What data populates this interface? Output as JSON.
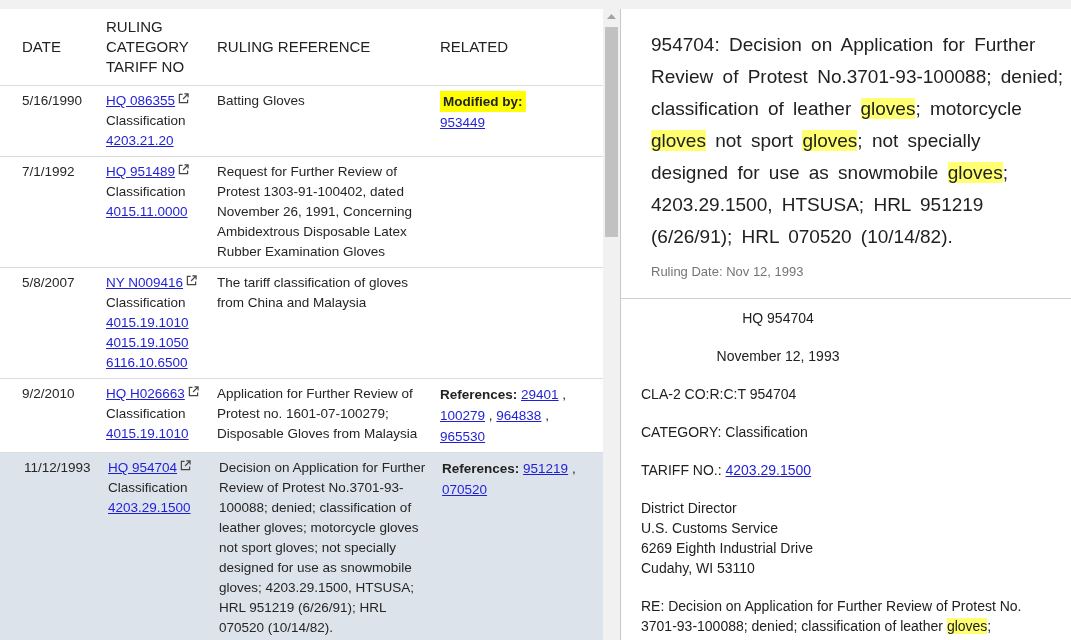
{
  "table": {
    "columns": [
      "DATE",
      "RULING CATEGORY TARIFF NO",
      "RULING REFERENCE",
      "RELATED"
    ],
    "rows": [
      {
        "selected": false,
        "date": "5/16/1990",
        "ruling": "HQ 086355",
        "category": "Classification",
        "tariffs": [
          "4203.21.20"
        ],
        "reference": "Batting Gloves",
        "related": {
          "label": "Modified by:",
          "highlighted": true,
          "links": [
            "953449"
          ]
        }
      },
      {
        "selected": false,
        "date": "7/1/1992",
        "ruling": "HQ 951489",
        "category": "Classification",
        "tariffs": [
          "4015.11.0000"
        ],
        "reference": "Request for Further Review of Protest 1303-91-100402, dated November 26, 1991, Concerning Ambidextrous Disposable Latex Rubber Examination Gloves"
      },
      {
        "selected": false,
        "date": "5/8/2007",
        "ruling": "NY N009416",
        "category": "Classification",
        "tariffs": [
          "4015.19.1010",
          "4015.19.1050",
          "6116.10.6500"
        ],
        "reference": "The tariff classification of gloves from China and Malaysia"
      },
      {
        "selected": false,
        "date": "9/2/2010",
        "ruling": "HQ H026663",
        "category": "Classification",
        "tariffs": [
          "4015.19.1010"
        ],
        "reference": "Application for Further Review of Protest no. 1601-07-100279; Disposable Gloves from Malaysia",
        "related": {
          "label": "References:",
          "highlighted": false,
          "separator": ",",
          "links": [
            "29401",
            "100279",
            "964838",
            "965530"
          ]
        }
      },
      {
        "selected": true,
        "date": "11/12/1993",
        "ruling": "HQ 954704",
        "category": "Classification",
        "tariffs": [
          "4203.29.1500"
        ],
        "reference": "Decision on Application for Further Review of Protest No.3701-93-100088; denied; classification of leather gloves; motorcycle gloves not sport gloves; not specially designed for use as snowmobile gloves; 4203.29.1500, HTSUSA; HRL 951219 (6/26/91); HRL 070520 (10/14/82).",
        "related": {
          "label": "References:",
          "highlighted": false,
          "separator": ",",
          "links": [
            "951219",
            "070520"
          ]
        }
      }
    ]
  },
  "detail": {
    "summary": [
      {
        "kind": "text",
        "text": "954704: Decision on Application for Further Review of Protest No.3701-93-100088; denied; classification of leather "
      },
      {
        "kind": "highlight",
        "text": "gloves"
      },
      {
        "kind": "text",
        "text": "; motorcycle "
      },
      {
        "kind": "highlight",
        "text": "gloves"
      },
      {
        "kind": "text",
        "text": " not sport "
      },
      {
        "kind": "highlight",
        "text": "gloves"
      },
      {
        "kind": "text",
        "text": "; not specially designed for use as snowmobile "
      },
      {
        "kind": "highlight",
        "text": "gloves"
      },
      {
        "kind": "text",
        "text": "; 4203.29.1500, HTSUSA; HRL 951219 (6/26/91); HRL 070520 (10/14/82)."
      }
    ],
    "ruling_date": "Ruling Date: Nov 12, 1993",
    "document": [
      {
        "kind": "centered",
        "lines": [
          [
            {
              "kind": "text",
              "text": "HQ 954704"
            }
          ]
        ]
      },
      {
        "kind": "centered",
        "lines": [
          [
            {
              "kind": "text",
              "text": "November 12, 1993"
            }
          ]
        ]
      },
      {
        "kind": "plain",
        "lines": [
          [
            {
              "kind": "text",
              "text": "CLA-2 CO:R:C:T 954704"
            }
          ]
        ]
      },
      {
        "kind": "plain",
        "lines": [
          [
            {
              "kind": "text",
              "text": "CATEGORY: Classification"
            }
          ]
        ]
      },
      {
        "kind": "plain",
        "lines": [
          [
            {
              "kind": "text",
              "text": "TARIFF NO.: "
            },
            {
              "kind": "link",
              "text": "4203.29.1500"
            }
          ]
        ]
      },
      {
        "kind": "plain",
        "lines": [
          [
            {
              "kind": "text",
              "text": "District Director"
            }
          ],
          [
            {
              "kind": "text",
              "text": "U.S. Customs Service"
            }
          ],
          [
            {
              "kind": "text",
              "text": "6269 Eighth Industrial Drive"
            }
          ],
          [
            {
              "kind": "text",
              "text": "Cudahy, WI 53110"
            }
          ]
        ]
      },
      {
        "kind": "plain",
        "lines": [
          [
            {
              "kind": "text",
              "text": "RE: Decision on Application for Further Review of Protest No. 3701-93-100088; denied; classification of leather "
            },
            {
              "kind": "highlight",
              "text": "gloves"
            },
            {
              "kind": "text",
              "text": ";"
            }
          ]
        ]
      }
    ]
  }
}
